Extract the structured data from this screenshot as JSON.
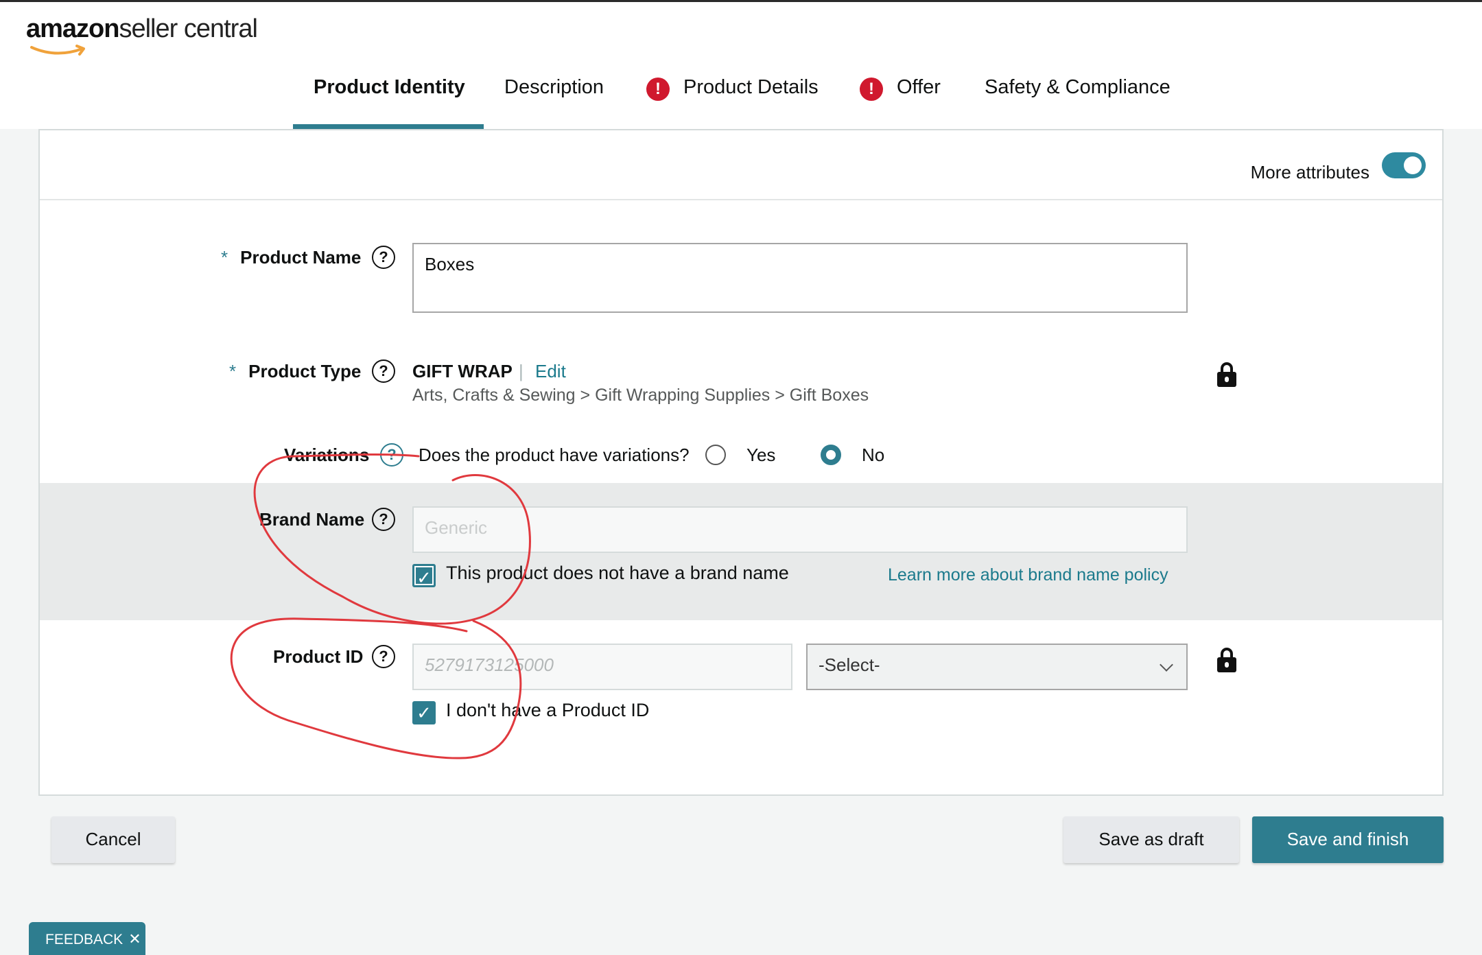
{
  "header": {
    "logo_amazon": "amazon",
    "logo_seller": "seller central"
  },
  "tabs": [
    {
      "label": "Product Identity",
      "active": true,
      "alert": false
    },
    {
      "label": "Description",
      "active": false,
      "alert": false
    },
    {
      "label": "Product Details",
      "active": false,
      "alert": true
    },
    {
      "label": "Offer",
      "active": false,
      "alert": true
    },
    {
      "label": "Safety & Compliance",
      "active": false,
      "alert": false
    }
  ],
  "alert_symbol": "!",
  "panel": {
    "more_attributes_label": "More attributes",
    "more_attributes_on": true
  },
  "product_name": {
    "required_mark": "*",
    "label": "Product Name",
    "value": "Boxes"
  },
  "product_type": {
    "required_mark": "*",
    "label": "Product Type",
    "name": "GIFT WRAP",
    "separator": "|",
    "edit_label": "Edit",
    "path": "Arts, Crafts & Sewing > Gift Wrapping Supplies > Gift Boxes"
  },
  "variations": {
    "label": "Variations",
    "question": "Does the product have variations?",
    "options": [
      "Yes",
      "No"
    ],
    "selected": "No"
  },
  "brand_name": {
    "label": "Brand Name",
    "placeholder": "Generic",
    "no_brand_label": "This product does not have a brand name",
    "no_brand_checked": true,
    "policy_link": "Learn more about brand name policy"
  },
  "product_id": {
    "label": "Product ID",
    "placeholder": "5279173125000",
    "select_value": "-Select-",
    "no_id_label": "I don't have a Product ID",
    "no_id_checked": true
  },
  "help_symbol": "?",
  "check_symbol": "✓",
  "actions": {
    "cancel": "Cancel",
    "save_draft": "Save as draft",
    "save_finish": "Save and finish"
  },
  "feedback": {
    "label": "FEEDBACK",
    "close": "✕"
  },
  "colors": {
    "accent": "#2e7d8f",
    "alert": "#d0192e",
    "annotation": "#e0393e"
  }
}
